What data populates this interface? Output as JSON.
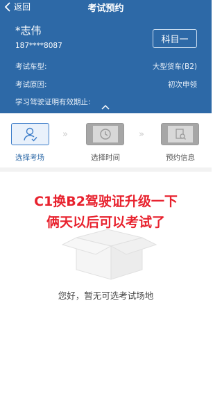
{
  "nav": {
    "back_label": "返回",
    "title": "考试预约"
  },
  "user": {
    "name": "*志伟",
    "phone": "187****8087"
  },
  "subject_button": "科目一",
  "info": [
    {
      "label": "考试车型:",
      "value": "大型货车(B2)"
    },
    {
      "label": "考试原因:",
      "value": "初次申领"
    },
    {
      "label": "学习驾驶证明有效期止:",
      "value": ""
    }
  ],
  "steps": [
    {
      "label": "选择考场",
      "icon": "person-check-icon",
      "active": true
    },
    {
      "label": "选择时间",
      "icon": "clock-icon",
      "active": false
    },
    {
      "label": "预约信息",
      "icon": "document-search-icon",
      "active": false
    }
  ],
  "overlay_text": [
    "C1换B2驾驶证升级一下",
    "俩天以后可以考试了"
  ],
  "empty_state": {
    "icon": "empty-box-icon",
    "message": "您好，暂无可选考试场地"
  },
  "colors": {
    "header_blue": "#2d69a7",
    "overlay_red": "#e8222e",
    "step_active": "#3a7bc8"
  }
}
